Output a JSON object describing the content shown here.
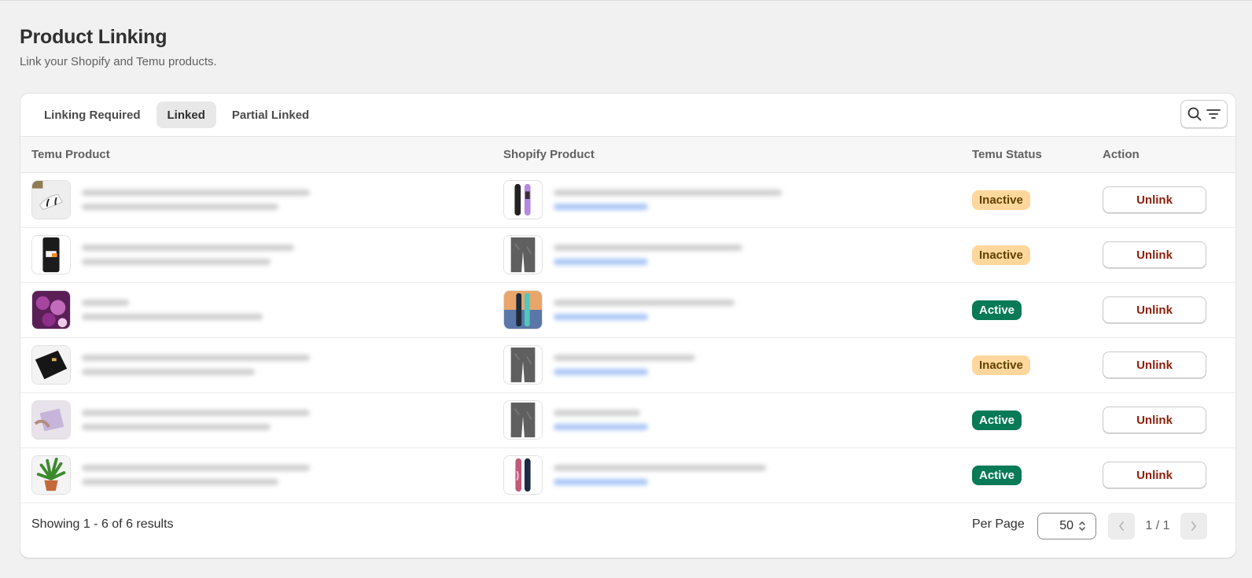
{
  "page": {
    "title": "Product Linking",
    "subtitle": "Link your Shopify and Temu products."
  },
  "tabs": [
    {
      "label": "Linking Required",
      "active": false
    },
    {
      "label": "Linked",
      "active": true
    },
    {
      "label": "Partial Linked",
      "active": false
    }
  ],
  "toolbar": {
    "search_icon": "search-icon",
    "filter_icon": "filter-icon"
  },
  "table": {
    "headers": {
      "temu_product": "Temu Product",
      "shopify_product": "Shopify Product",
      "temu_status": "Temu Status",
      "action": "Action"
    },
    "rows": [
      {
        "temu_thumb": "earbuds",
        "shopify_thumb": "snowboard-pair-purple",
        "status": "Inactive",
        "action": "Unlink"
      },
      {
        "temu_thumb": "phone-case",
        "shopify_thumb": "gray-pants",
        "status": "Inactive",
        "action": "Unlink"
      },
      {
        "temu_thumb": "purple-flowers",
        "shopify_thumb": "snowboard-teal",
        "status": "Active",
        "action": "Unlink"
      },
      {
        "temu_thumb": "black-wallet",
        "shopify_thumb": "gray-pants",
        "status": "Inactive",
        "action": "Unlink"
      },
      {
        "temu_thumb": "lavender-bag",
        "shopify_thumb": "gray-pants",
        "status": "Active",
        "action": "Unlink"
      },
      {
        "temu_thumb": "potted-plant",
        "shopify_thumb": "snowboard-pink",
        "status": "Active",
        "action": "Unlink"
      }
    ]
  },
  "footer": {
    "results": "Showing 1 - 6 of 6 results",
    "per_page_label": "Per Page",
    "per_page_value": "50",
    "page_indicator": "1 / 1"
  },
  "colors": {
    "active_badge": "#087a56",
    "inactive_badge": "#ffd79d",
    "unlink_text": "#8e1f0b"
  }
}
